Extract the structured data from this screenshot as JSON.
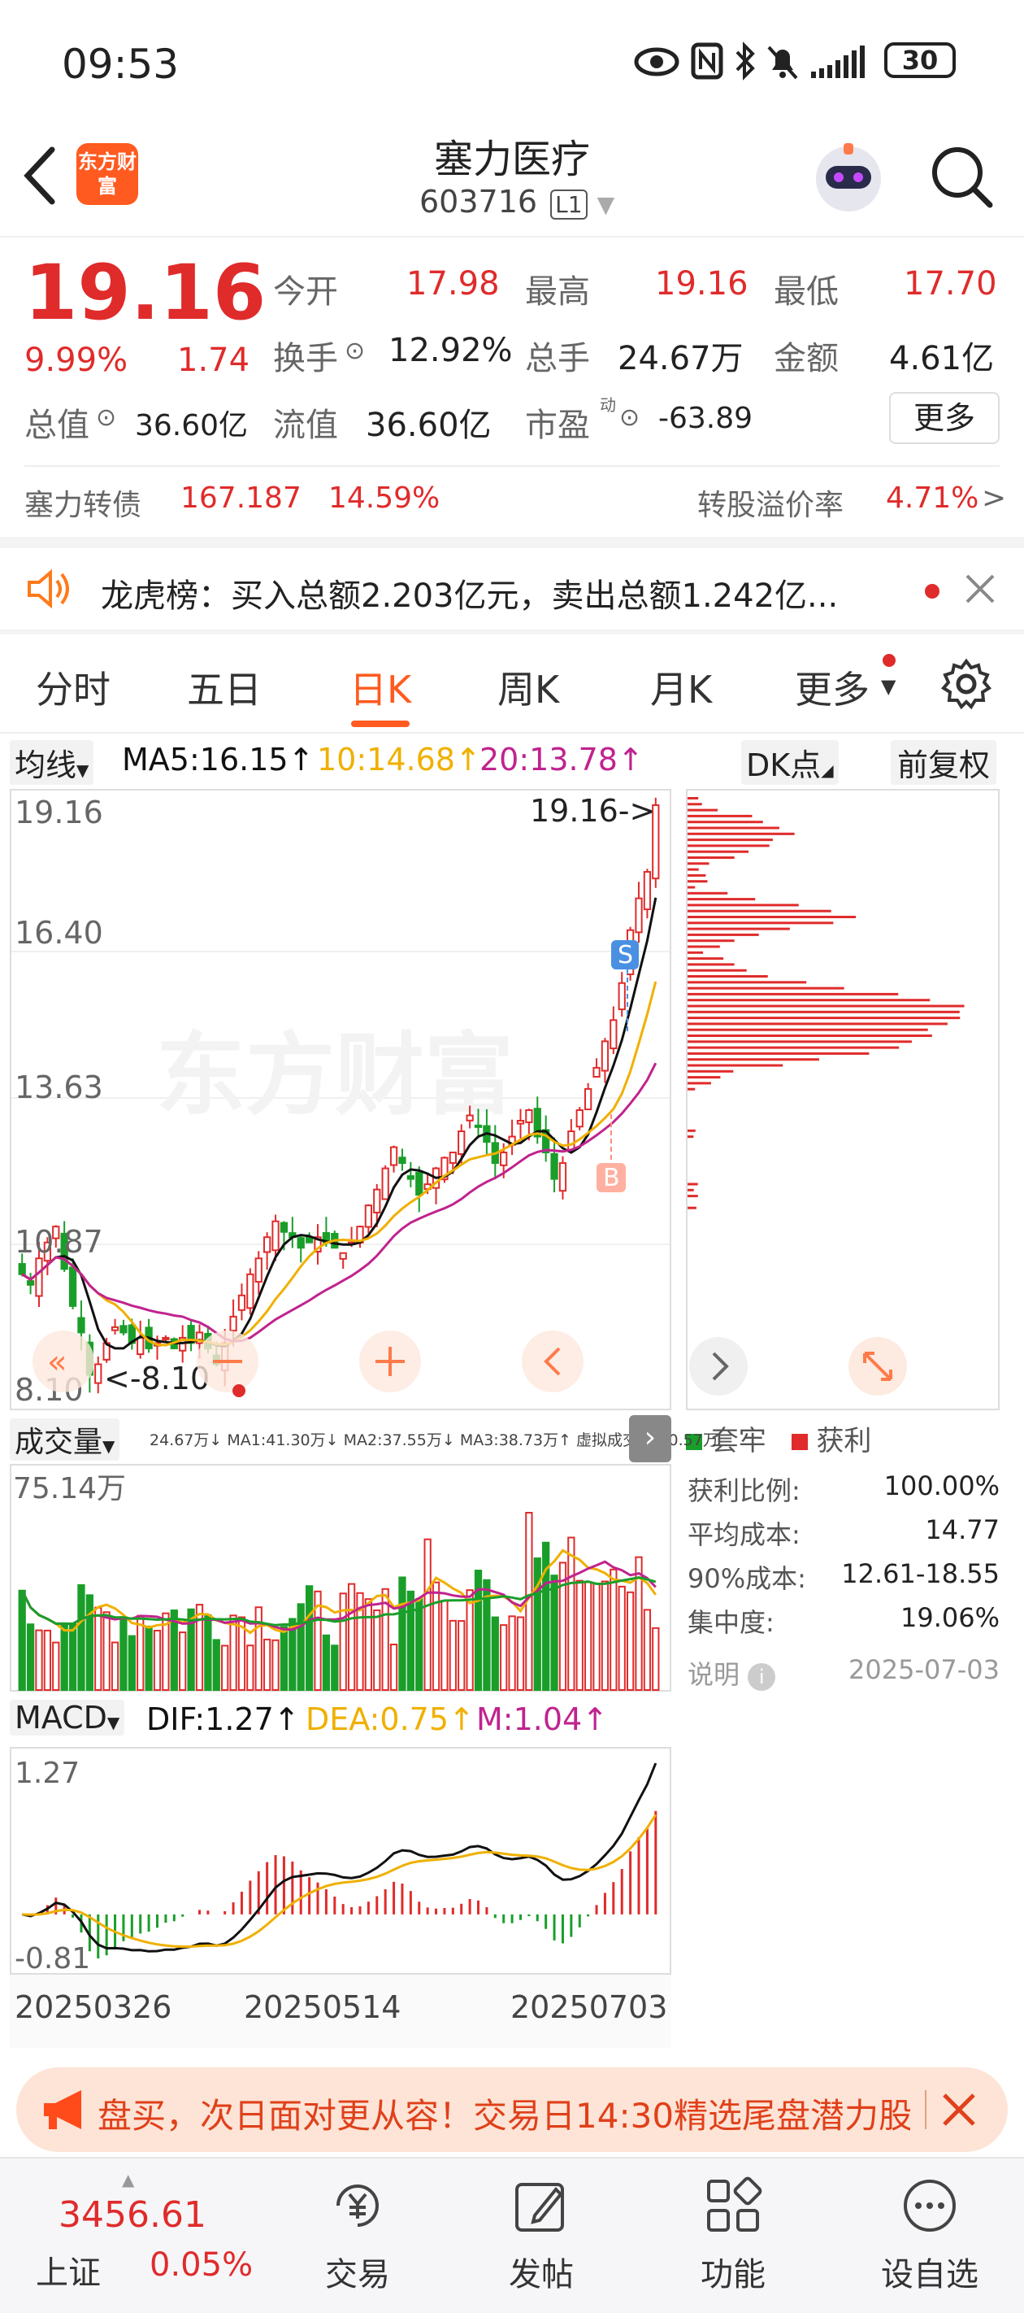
{
  "status_bar": {
    "time": "09:53",
    "battery": "30"
  },
  "header": {
    "title": "塞力医疗",
    "code": "603716",
    "level": "L1",
    "logo_text": "东方财富"
  },
  "quote": {
    "price": "19.16",
    "change_pct": "9.99%",
    "change_amt": "1.74",
    "open_label": "今开",
    "open": "17.98",
    "high_label": "最高",
    "high": "19.16",
    "low_label": "最低",
    "low": "17.70",
    "turnover_label": "换手",
    "turnover": "12.92%",
    "volume_label": "总手",
    "volume": "24.67万",
    "amount_label": "金额",
    "amount": "4.61亿",
    "mktcap_label": "总值",
    "mktcap": "36.60亿",
    "float_label": "流值",
    "float_cap": "36.60亿",
    "pe_label": "市盈",
    "pe_sup": "动",
    "pe": "-63.89",
    "more_btn": "更多"
  },
  "bond": {
    "name": "塞力转债",
    "price": "167.187",
    "pct": "14.59%",
    "premium_label": "转股溢价率",
    "premium": "4.71%",
    "arrow": ">"
  },
  "news": {
    "text": "龙虎榜：买入总额2.203亿元，卖出总额1.242亿..."
  },
  "tabs": [
    "分时",
    "五日",
    "日K",
    "周K",
    "月K",
    "更多"
  ],
  "active_tab": 2,
  "ma_bar": {
    "selector": "均线",
    "ma5": "MA5:16.15↑",
    "ma10": "10:14.68↑",
    "ma20": "20:13.78↑",
    "dk": "DK点",
    "fq": "前复权"
  },
  "kline": {
    "y_labels": [
      "19.16",
      "16.40",
      "13.63",
      "10.87",
      "8.10"
    ],
    "max_tag": "19.16->",
    "min_tag": "<-8.10",
    "watermark": "东方财富",
    "s_badge": "S",
    "b_badge": "B"
  },
  "volume_bar": {
    "selector": "成交量",
    "info": "24.67万↓ MA1:41.30万↓ MA2:37.55万↓ MA3:38.73万↑ 虚拟成交量:30.57万",
    "y_label": "75.14万"
  },
  "macd_bar": {
    "selector": "MACD",
    "dif": "DIF:1.27↑",
    "dea": "DEA:0.75↑",
    "m": "M:1.04↑",
    "y_top": "1.27",
    "y_bottom": "-0.81"
  },
  "dates": [
    "20250326",
    "20250514",
    "20250703"
  ],
  "chip": {
    "legend_trapped": "套牢",
    "legend_profit": "获利",
    "rows": [
      {
        "label": "获利比例:",
        "value": "100.00%"
      },
      {
        "label": "平均成本:",
        "value": "14.77"
      },
      {
        "label": "90%成本:",
        "value": "12.61-18.55"
      },
      {
        "label": "集中度:",
        "value": "19.06%"
      }
    ],
    "note_label": "说明",
    "date": "2025-07-03"
  },
  "promo": {
    "text": "盘买，次日面对更从容！交易日14:30精选尾盘潜力股"
  },
  "bottom_nav": {
    "index_value": "3456.61",
    "index_name": "上证",
    "index_pct": "0.05%",
    "items": [
      "交易",
      "发帖",
      "功能",
      "设自选"
    ]
  },
  "colors": {
    "up": "#e02b2b",
    "down": "#1a9e2a",
    "ma5": "#111111",
    "ma10": "#f0b000",
    "ma20": "#c0238e",
    "accent": "#ff5a1f"
  },
  "chart_data": {
    "type": "candlestick",
    "price_range": [
      8.1,
      19.16
    ],
    "close_series": [
      10.3,
      10.1,
      10.6,
      10.9,
      11.2,
      10.4,
      9.7,
      9.2,
      8.4,
      8.6,
      9.0,
      9.3,
      9.2,
      9.0,
      9.1,
      8.9,
      9.0,
      9.1,
      8.9,
      9.1,
      9.0,
      9.2,
      8.9,
      8.6,
      9.0,
      9.5,
      9.9,
      10.3,
      10.6,
      11.0,
      11.3,
      11.1,
      11.0,
      10.8,
      10.9,
      11.0,
      10.9,
      10.8,
      10.7,
      10.9,
      11.2,
      11.6,
      11.9,
      12.3,
      12.7,
      12.4,
      12.1,
      11.8,
      12.0,
      12.3,
      12.5,
      12.6,
      13.0,
      13.3,
      13.1,
      12.8,
      12.4,
      12.6,
      12.9,
      13.2,
      13.4,
      12.9,
      12.6,
      12.1,
      12.4,
      13.0,
      13.4,
      13.8,
      14.2,
      14.7,
      15.1,
      15.8,
      16.8,
      17.4,
      17.9,
      19.16
    ]
  }
}
